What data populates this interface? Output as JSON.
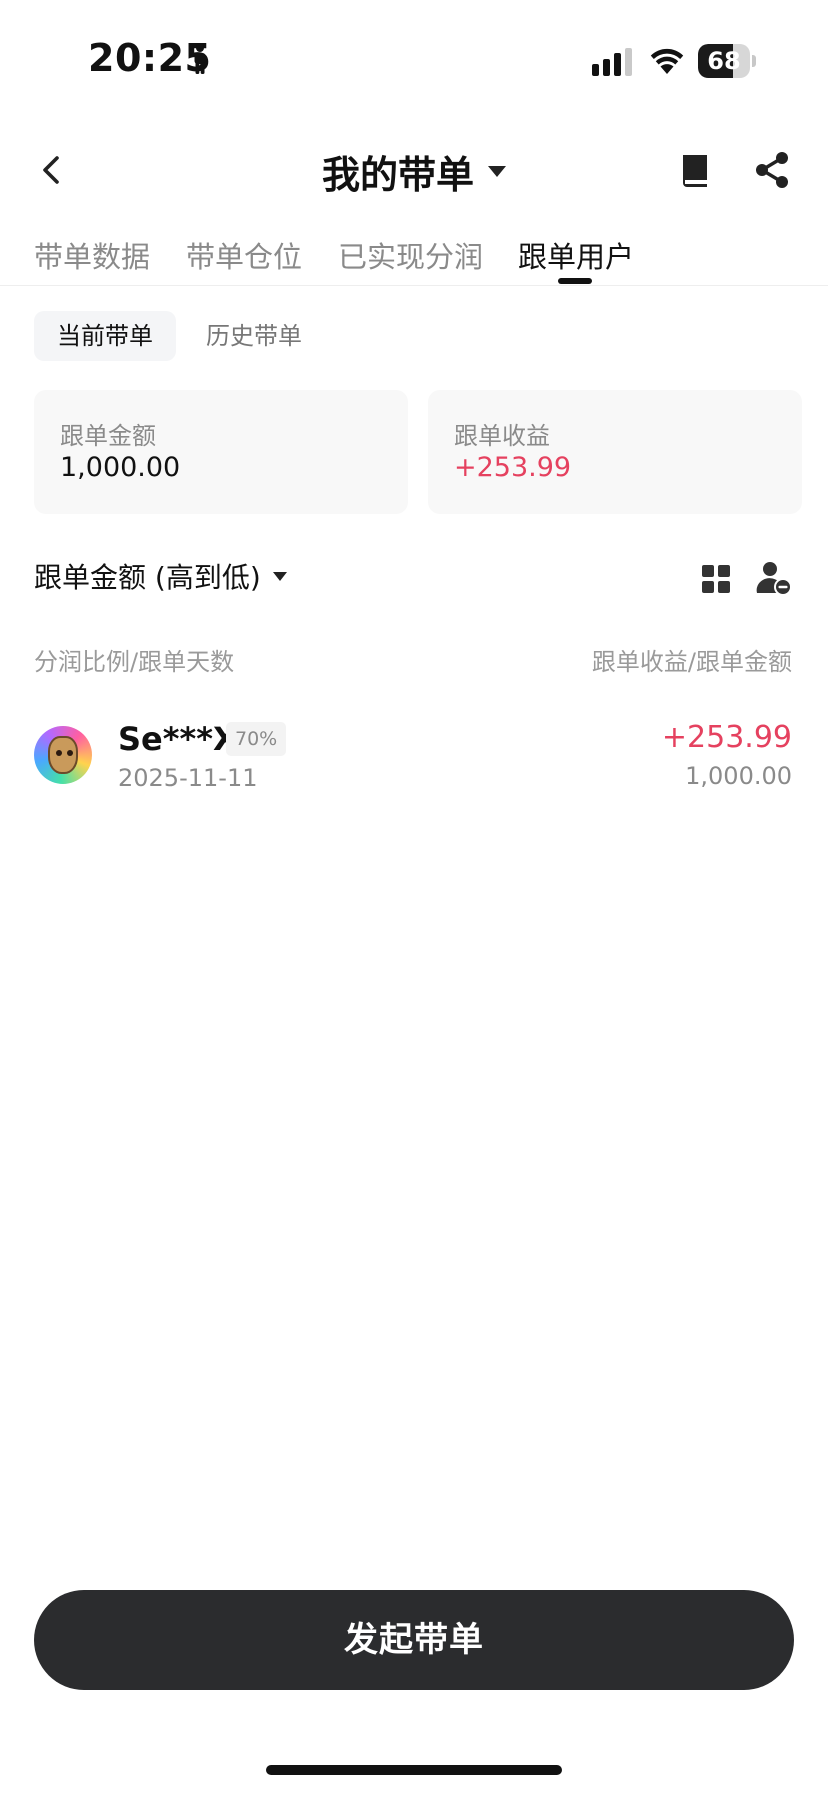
{
  "status_bar": {
    "time": "20:25",
    "battery": {
      "level": "68",
      "fraction": 0.68
    }
  },
  "header": {
    "title": "我的带单",
    "icons": [
      "back-icon",
      "caret-down-icon",
      "book-icon",
      "share-icon"
    ]
  },
  "tabs": [
    {
      "label": "带单数据",
      "active": false
    },
    {
      "label": "带单仓位",
      "active": false
    },
    {
      "label": "已实现分润",
      "active": false
    },
    {
      "label": "跟单用户",
      "active": true
    }
  ],
  "sub_tabs": [
    {
      "label": "当前带单",
      "active": true
    },
    {
      "label": "历史带单",
      "active": false
    }
  ],
  "summary": {
    "amount": {
      "label": "跟单金额",
      "value": "1,000.00"
    },
    "profit": {
      "label": "跟单收益",
      "value": "+253.99"
    }
  },
  "sort": {
    "label": "跟单金额 (高到低)"
  },
  "columns": {
    "left": "分润比例/跟单天数",
    "right": "跟单收益/跟单金额"
  },
  "followers": [
    {
      "name": "Se***X",
      "ratio": "70%",
      "date": "2025-11-11",
      "profit": "+253.99",
      "amount": "1,000.00"
    }
  ],
  "cta": {
    "label": "发起带单"
  },
  "colors": {
    "positive": "#e5415f",
    "cta_bg": "#2b2c2e",
    "muted": "#8a8a8a"
  }
}
